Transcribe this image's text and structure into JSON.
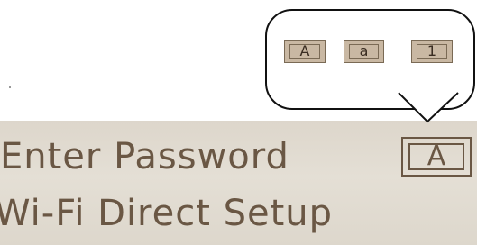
{
  "callout": {
    "keys": [
      {
        "label": "A"
      },
      {
        "label": "a"
      },
      {
        "label": "1"
      }
    ]
  },
  "lcd": {
    "rows": [
      {
        "label": "Enter Password"
      },
      {
        "label": "Wi-Fi Direct Setup"
      }
    ],
    "mode_indicator": "A"
  },
  "colors": {
    "lcd_background": "#e0dacf",
    "lcd_text": "#6a5744",
    "key_fill": "#c9b8a3"
  }
}
